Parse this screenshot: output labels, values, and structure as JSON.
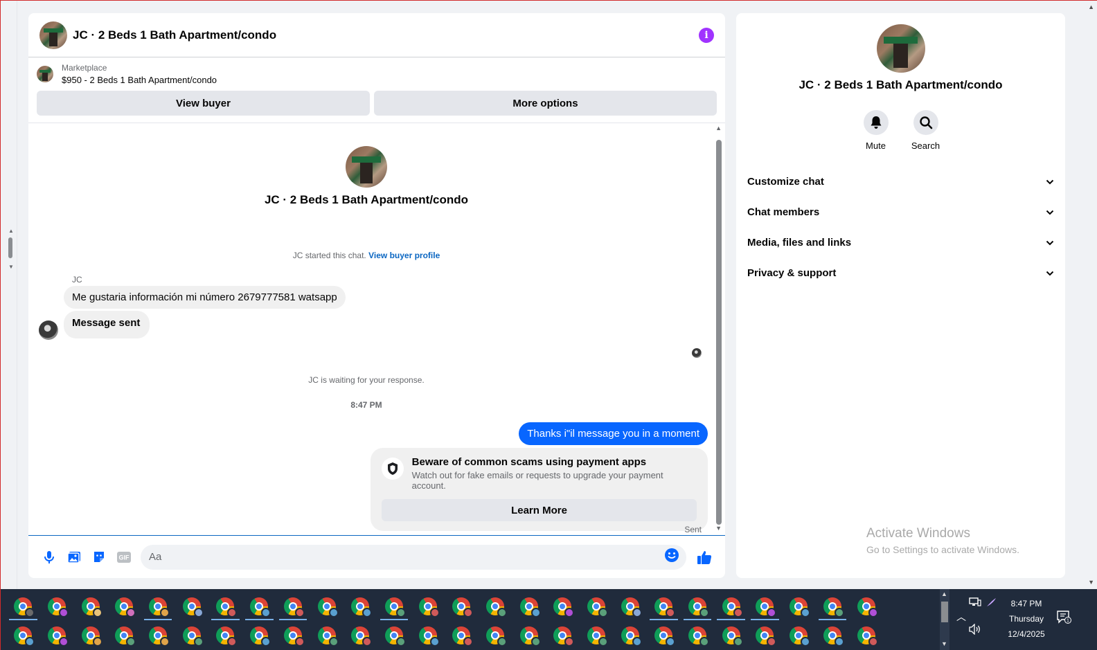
{
  "chat": {
    "title": "JC · 2 Beds 1 Bath Apartment/condo",
    "listing_source": "Marketplace",
    "listing_price_title": "$950 - 2 Beds 1 Bath Apartment/condo",
    "view_buyer_label": "View buyer",
    "more_options_label": "More options",
    "intro_name": "JC · 2 Beds 1 Bath Apartment/condo",
    "started_text": "JC started this chat.",
    "view_buyer_profile_label": "View buyer profile",
    "sender_name": "JC",
    "incoming_messages": [
      "Me gustaria información mi número 2679777581 watsapp",
      "Message sent"
    ],
    "waiting_text": "JC is waiting for your response.",
    "timestamp": "8:47 PM",
    "outgoing_message": "Thanks i\"il message you in a moment",
    "scam_title": "Beware of common scams using payment apps",
    "scam_desc": "Watch out for fake emails or requests to upgrade your payment account.",
    "learn_more_label": "Learn More",
    "status": "Sent",
    "composer_placeholder": "Aa"
  },
  "details": {
    "name": "JC · 2 Beds 1 Bath Apartment/condo",
    "actions": [
      {
        "label": "Mute",
        "icon": "bell-icon"
      },
      {
        "label": "Search",
        "icon": "search-icon"
      }
    ],
    "sections": [
      "Customize chat",
      "Chat members",
      "Media, files and links",
      "Privacy & support"
    ]
  },
  "watermark": {
    "line1": "Activate Windows",
    "line2": "Go to Settings to activate Windows."
  },
  "taskbar": {
    "time": "8:47 PM",
    "day": "Thursday",
    "date": "12/4/2025",
    "notification_count": "1",
    "app_icon": "chrome-icon",
    "rows": [
      [
        "#6b6b6b",
        "#b04fd6",
        "#e8c37a",
        "#d06fbb",
        "#e0a44a",
        "#88a7d6",
        "#d05a5a",
        "#5aa0d0",
        "#d05a5a",
        "#5aa0d0",
        "#5aa0d0",
        "#5aa07a",
        "#d05a5a",
        "#d05a5a",
        "#5aa07a",
        "#5aa0d0",
        "#b04fd6",
        "#5aa07a",
        "#88a7d6",
        "#d05a5a",
        "#5aa07a",
        "#d05a5a",
        "#b04fd6",
        "#5aa0d0",
        "#5aa07a",
        "#b04fd6"
      ],
      [
        "#5aa0d0",
        "#b04fd6",
        "#e0a44a",
        "#5aa07a",
        "#e0a44a",
        "#5aa07a",
        "#d05a5a",
        "#5aa0d0",
        "#d05a5a",
        "#5aa07a",
        "#d05a5a",
        "#5aa07a",
        "#5aa0d0",
        "#d05a5a",
        "#5aa07a",
        "#5aa07a",
        "#d05a5a",
        "#5aa07a",
        "#5aa0d0",
        "#5aa0d0",
        "#5aa07a",
        "#5aa07a",
        "#d05a5a",
        "#5aa0d0",
        "#5aa0d0",
        "#d05a5a"
      ]
    ]
  },
  "colors": {
    "accent_blue": "#0866ff",
    "info_purple": "#a033ff",
    "link_blue": "#0a66c2"
  }
}
